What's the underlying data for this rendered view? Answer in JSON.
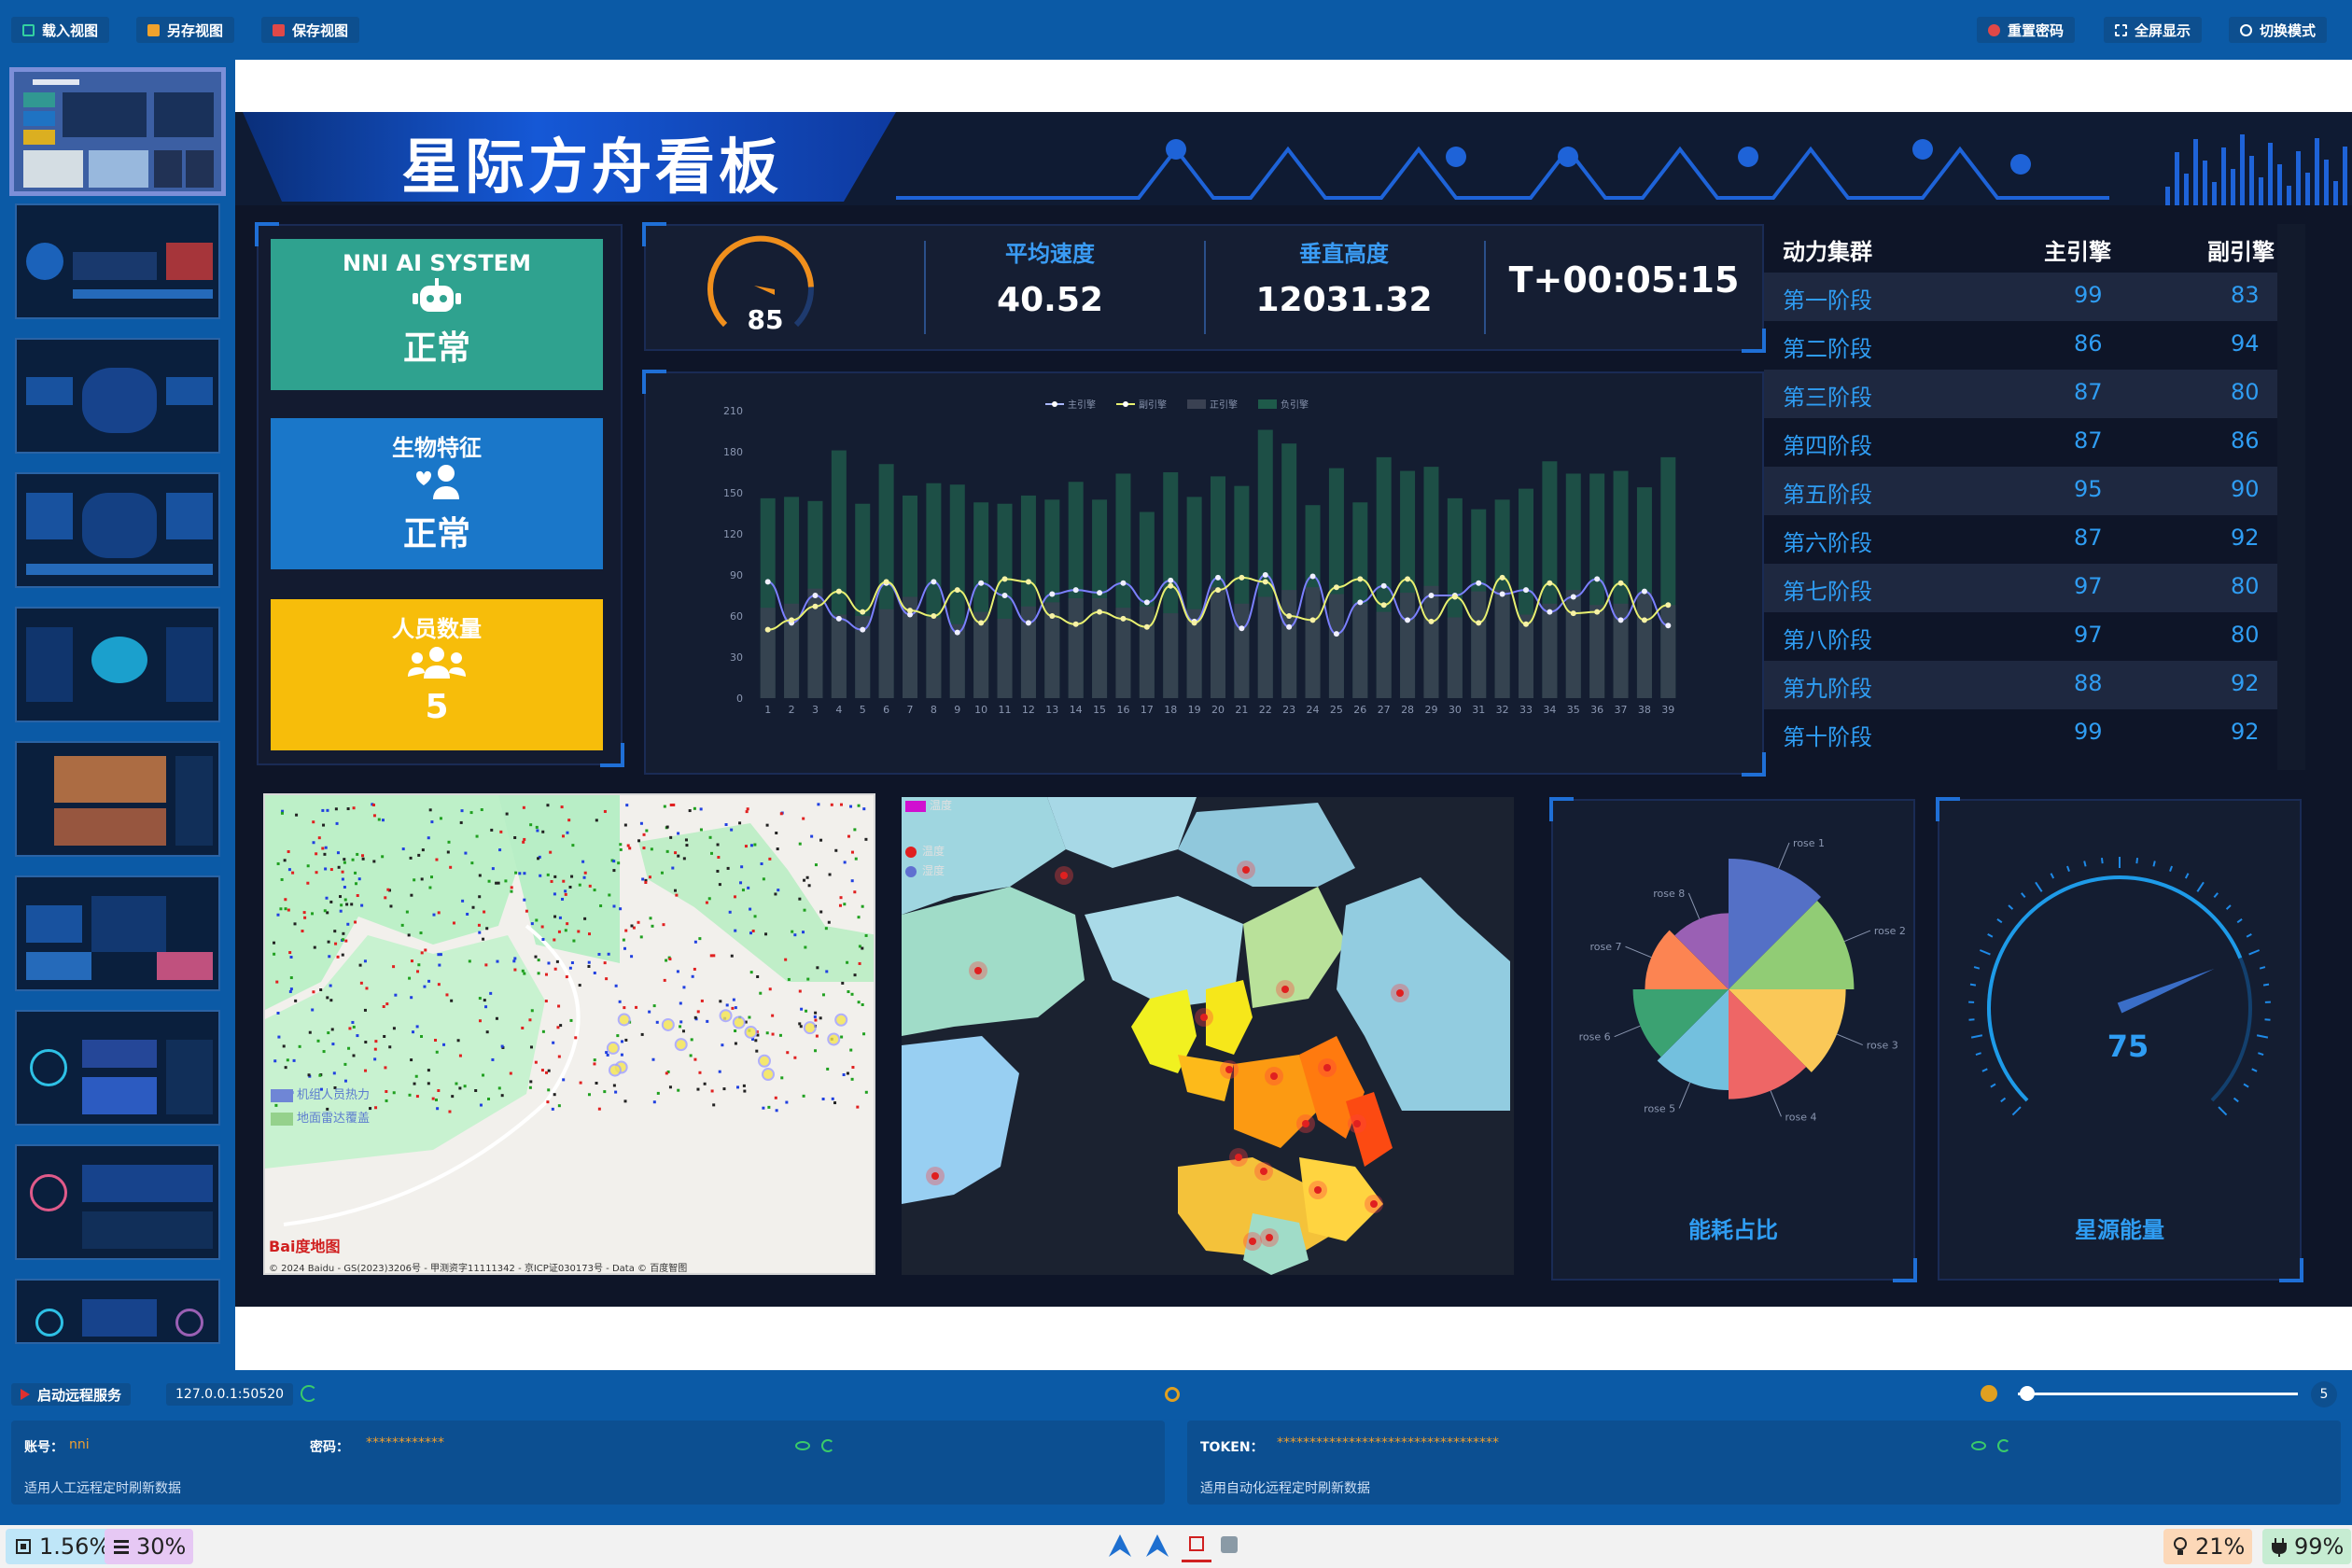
{
  "toolbar": {
    "load_view": "载入视图",
    "save_as_view": "另存视图",
    "save_view": "保存视图",
    "reset_password": "重置密码",
    "fullscreen": "全屏显示",
    "switch_mode": "切换模式"
  },
  "dashboard": {
    "title": "星际方舟看板",
    "cards": [
      {
        "title": "NNI AI SYSTEM",
        "value": "正常",
        "color": "#2fa28f",
        "icon": "robot-icon"
      },
      {
        "title": "生物特征",
        "value": "正常",
        "color": "#1a77c9",
        "icon": "user-heart-icon"
      },
      {
        "title": "人员数量",
        "value": "5",
        "color": "#f7bd0a",
        "icon": "users-icon"
      }
    ],
    "gauge_small": {
      "value": "85"
    },
    "stats": [
      {
        "label": "平均速度",
        "value": "40.52"
      },
      {
        "label": "垂直高度",
        "value": "12031.32"
      }
    ],
    "timer": "T+00:05:15",
    "table": {
      "headers": [
        "动力集群",
        "主引擎",
        "副引擎"
      ],
      "rows": [
        [
          "第一阶段",
          "99",
          "83"
        ],
        [
          "第二阶段",
          "86",
          "94"
        ],
        [
          "第三阶段",
          "87",
          "80"
        ],
        [
          "第四阶段",
          "87",
          "86"
        ],
        [
          "第五阶段",
          "95",
          "90"
        ],
        [
          "第六阶段",
          "87",
          "92"
        ],
        [
          "第七阶段",
          "97",
          "80"
        ],
        [
          "第八阶段",
          "97",
          "80"
        ],
        [
          "第九阶段",
          "88",
          "92"
        ],
        [
          "第十阶段",
          "99",
          "92"
        ]
      ]
    },
    "heatmap_legend": [
      "机组人员热力",
      "地面雷达覆盖"
    ],
    "map_attribution": "© 2024 Baidu - GS(2023)3206号 - 甲测资字11111342 - 京ICP证030173号 - Data © 百度智图",
    "baidu_logo": "Bai度地图",
    "region_legend": [
      "温度",
      "温度",
      "湿度"
    ],
    "pie_title": "能耗占比",
    "gauge_big_title": "星源能量",
    "gauge_big_value": "75"
  },
  "chart_data": [
    {
      "type": "bar",
      "legend": [
        "主引擎",
        "副引擎",
        "正引擎",
        "负引擎"
      ],
      "ylim": [
        0,
        210
      ],
      "yticks": [
        0,
        30,
        60,
        90,
        120,
        150,
        180,
        210
      ],
      "categories": [
        "1",
        "2",
        "3",
        "4",
        "5",
        "6",
        "7",
        "8",
        "9",
        "10",
        "11",
        "12",
        "13",
        "14",
        "15",
        "16",
        "17",
        "18",
        "19",
        "20",
        "21",
        "22",
        "23",
        "24",
        "25",
        "26",
        "27",
        "28",
        "29",
        "30",
        "31",
        "32",
        "33",
        "34",
        "35",
        "36",
        "37",
        "38",
        "39"
      ],
      "series": [
        {
          "name": "正引擎",
          "values": [
            66,
            69,
            80,
            61,
            60,
            65,
            74,
            59,
            54,
            63,
            58,
            67,
            70,
            73,
            73,
            66,
            67,
            62,
            65,
            81,
            69,
            74,
            79,
            81,
            76,
            69,
            63,
            77,
            82,
            59,
            78,
            79,
            61,
            69,
            79,
            68,
            69,
            77,
            68
          ]
        },
        {
          "name": "负引擎",
          "values": [
            146,
            147,
            144,
            181,
            142,
            171,
            148,
            157,
            156,
            143,
            142,
            148,
            145,
            158,
            145,
            164,
            136,
            165,
            147,
            162,
            155,
            196,
            186,
            141,
            168,
            143,
            176,
            166,
            169,
            146,
            138,
            145,
            153,
            173,
            164,
            164,
            166,
            154,
            176
          ]
        },
        {
          "name": "主引擎",
          "values": [
            85,
            55,
            75,
            58,
            50,
            84,
            61,
            85,
            48,
            84,
            75,
            55,
            76,
            79,
            77,
            84,
            70,
            86,
            56,
            88,
            51,
            90,
            52,
            89,
            47,
            70,
            82,
            57,
            75,
            75,
            84,
            76,
            79,
            63,
            74,
            87,
            57,
            78,
            53
          ]
        },
        {
          "name": "副引擎",
          "values": [
            50,
            57,
            67,
            78,
            63,
            85,
            64,
            60,
            79,
            55,
            87,
            85,
            60,
            54,
            63,
            58,
            52,
            82,
            55,
            79,
            88,
            85,
            60,
            57,
            81,
            87,
            68,
            87,
            56,
            74,
            55,
            88,
            54,
            84,
            62,
            63,
            84,
            57,
            68
          ]
        }
      ]
    },
    {
      "type": "pie",
      "title": "能耗占比",
      "categories": [
        "rose 1",
        "rose 2",
        "rose 3",
        "rose 4",
        "rose 5",
        "rose 6",
        "rose 7",
        "rose 8"
      ],
      "values": [
        125,
        118,
        107,
        97,
        85,
        78,
        62,
        52
      ],
      "colors": [
        "#5470c6",
        "#91cc75",
        "#fac858",
        "#ee6666",
        "#73c0de",
        "#3ba272",
        "#fc8452",
        "#9a60b4"
      ]
    },
    {
      "type": "gauge",
      "title": "星源能量",
      "value": 75,
      "ylim": [
        0,
        100
      ]
    }
  ],
  "bottom": {
    "start_service": "启动远程服务",
    "address": "127.0.0.1:50520",
    "slider_value": "5",
    "account_label": "账号：",
    "account_value": "nni",
    "password_label": "密码：",
    "password_value": "************",
    "manual_hint": "适用人工远程定时刷新数据",
    "token_label": "TOKEN：",
    "token_value": "**********************************",
    "auto_hint": "适用自动化远程定时刷新数据"
  },
  "taskbar": {
    "cpu": "1.56%",
    "mem": "30%",
    "light": "21%",
    "battery": "99%"
  }
}
